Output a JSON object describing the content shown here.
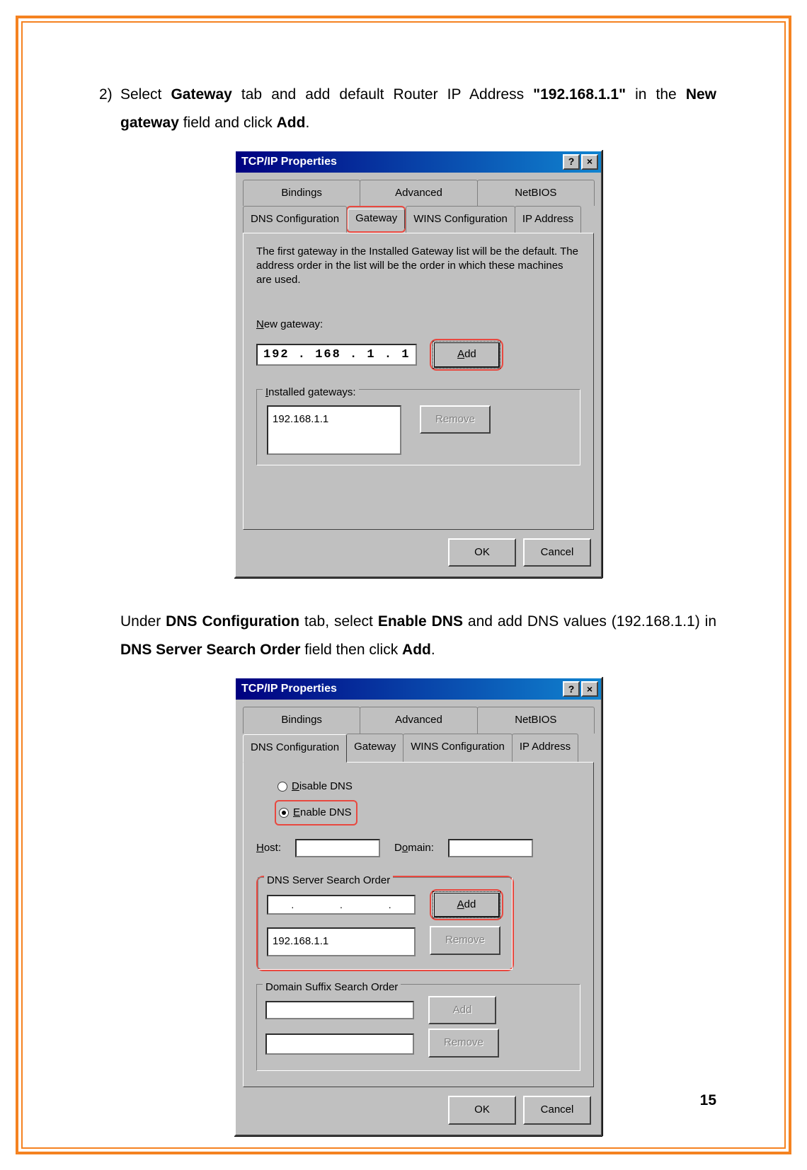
{
  "page_number": "15",
  "instruction1": {
    "num": "2)",
    "pre": "Select ",
    "b1": "Gateway",
    "mid1": " tab and add default Router IP Address ",
    "b2": "\"192.168.1.1\"",
    "mid2": " in the ",
    "b3": "New gateway",
    "mid3": " field and click ",
    "b4": "Add",
    "end": "."
  },
  "instruction2": {
    "pre": "Under ",
    "b1": "DNS Configuration",
    "mid1": " tab, select ",
    "b2": "Enable DNS",
    "mid2": " and add DNS values (192.168.1.1) in ",
    "b3": "DNS Server Search Order",
    "mid3": " field then click ",
    "b4": "Add",
    "end": "."
  },
  "dlg1": {
    "title": "TCP/IP Properties",
    "help_btn": "?",
    "close_btn": "×",
    "tabs_row1": [
      "Bindings",
      "Advanced",
      "NetBIOS"
    ],
    "tabs_row2": [
      "DNS Configuration",
      "Gateway",
      "WINS Configuration",
      "IP Address"
    ],
    "active_tab": "Gateway",
    "help_text": "The first gateway in the Installed Gateway list will be the default. The address order in the list will be the order in which these machines are used.",
    "new_gateway_label": "New gateway:",
    "new_gateway_value": "192 . 168 .  1  .  1",
    "add_btn": "Add",
    "installed_label": "Installed gateways:",
    "installed_value": "192.168.1.1",
    "remove_btn": "Remove",
    "ok_btn": "OK",
    "cancel_btn": "Cancel"
  },
  "dlg2": {
    "title": "TCP/IP Properties",
    "help_btn": "?",
    "close_btn": "×",
    "tabs_row1": [
      "Bindings",
      "Advanced",
      "NetBIOS"
    ],
    "tabs_row2": [
      "DNS Configuration",
      "Gateway",
      "WINS Configuration",
      "IP Address"
    ],
    "active_tab": "DNS Configuration",
    "radio_disable": "Disable DNS",
    "radio_enable": "Enable DNS",
    "host_label": "Host:",
    "domain_label": "Domain:",
    "dns_order_label": "DNS Server Search Order",
    "dns_add_btn": "Add",
    "dns_list_value": "192.168.1.1",
    "dns_remove_btn": "Remove",
    "suffix_label": "Domain Suffix Search Order",
    "suffix_add_btn": "Add",
    "suffix_remove_btn": "Remove",
    "ok_btn": "OK",
    "cancel_btn": "Cancel"
  }
}
